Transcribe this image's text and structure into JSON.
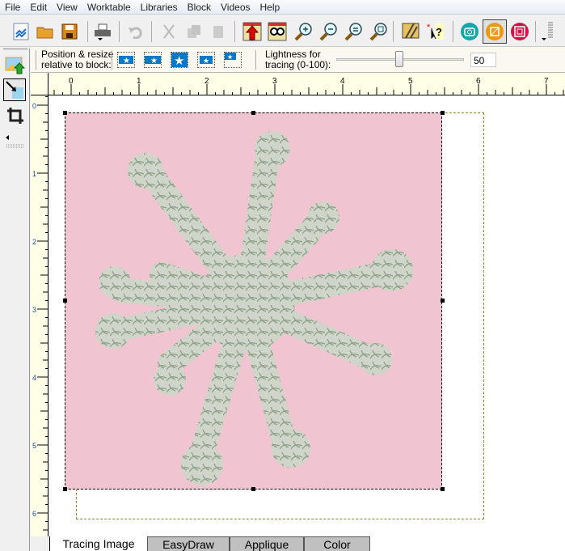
{
  "menu": [
    "File",
    "Edit",
    "View",
    "Worktable",
    "Libraries",
    "Block",
    "Videos",
    "Help"
  ],
  "toolbar": {
    "icons": [
      "new-quilt-icon",
      "open-folder-icon",
      "save-icon",
      "print-icon",
      "undo-icon",
      "cut-icon",
      "copy-icon",
      "paste-icon",
      "add-to-sketchbook-icon",
      "view-sketchbook-icon",
      "zoom-in-icon",
      "zoom-out-icon",
      "fit-to-worktable-icon",
      "refresh-icon",
      "video-icon",
      "whats-this-help-icon",
      "image-worktable-icon",
      "block-worktable-icon",
      "quilt-worktable-icon"
    ]
  },
  "options": {
    "position_label": "Position & resize\nrelative to block:",
    "lightness_label": "Lightness for\ntracing (0-100):",
    "lightness_value": "50",
    "lightness_percent": 50
  },
  "ruler": {
    "h": [
      "0",
      "1",
      "2",
      "3",
      "4",
      "5",
      "6",
      "7"
    ],
    "v": [
      "0",
      "1",
      "2",
      "3",
      "4",
      "5",
      "6"
    ]
  },
  "tabs": [
    "Tracing Image",
    "EasyDraw",
    "Applique",
    "Color"
  ],
  "colors": {
    "image_bg": "#f0c4d0",
    "fabric": "#c9d0c4",
    "block_outline": "#8a8a20"
  }
}
